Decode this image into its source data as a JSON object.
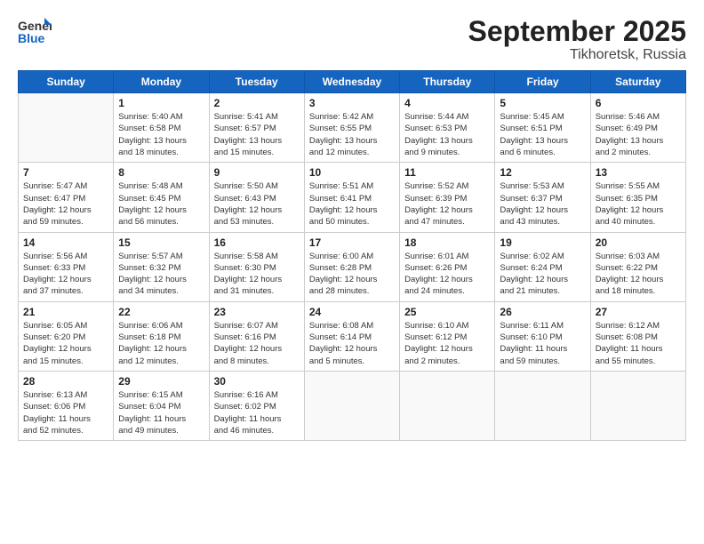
{
  "header": {
    "logo_general": "General",
    "logo_blue": "Blue",
    "title": "September 2025",
    "subtitle": "Tikhoretsk, Russia"
  },
  "days_of_week": [
    "Sunday",
    "Monday",
    "Tuesday",
    "Wednesday",
    "Thursday",
    "Friday",
    "Saturday"
  ],
  "weeks": [
    [
      {
        "day": "",
        "info": ""
      },
      {
        "day": "1",
        "info": "Sunrise: 5:40 AM\nSunset: 6:58 PM\nDaylight: 13 hours\nand 18 minutes."
      },
      {
        "day": "2",
        "info": "Sunrise: 5:41 AM\nSunset: 6:57 PM\nDaylight: 13 hours\nand 15 minutes."
      },
      {
        "day": "3",
        "info": "Sunrise: 5:42 AM\nSunset: 6:55 PM\nDaylight: 13 hours\nand 12 minutes."
      },
      {
        "day": "4",
        "info": "Sunrise: 5:44 AM\nSunset: 6:53 PM\nDaylight: 13 hours\nand 9 minutes."
      },
      {
        "day": "5",
        "info": "Sunrise: 5:45 AM\nSunset: 6:51 PM\nDaylight: 13 hours\nand 6 minutes."
      },
      {
        "day": "6",
        "info": "Sunrise: 5:46 AM\nSunset: 6:49 PM\nDaylight: 13 hours\nand 2 minutes."
      }
    ],
    [
      {
        "day": "7",
        "info": "Sunrise: 5:47 AM\nSunset: 6:47 PM\nDaylight: 12 hours\nand 59 minutes."
      },
      {
        "day": "8",
        "info": "Sunrise: 5:48 AM\nSunset: 6:45 PM\nDaylight: 12 hours\nand 56 minutes."
      },
      {
        "day": "9",
        "info": "Sunrise: 5:50 AM\nSunset: 6:43 PM\nDaylight: 12 hours\nand 53 minutes."
      },
      {
        "day": "10",
        "info": "Sunrise: 5:51 AM\nSunset: 6:41 PM\nDaylight: 12 hours\nand 50 minutes."
      },
      {
        "day": "11",
        "info": "Sunrise: 5:52 AM\nSunset: 6:39 PM\nDaylight: 12 hours\nand 47 minutes."
      },
      {
        "day": "12",
        "info": "Sunrise: 5:53 AM\nSunset: 6:37 PM\nDaylight: 12 hours\nand 43 minutes."
      },
      {
        "day": "13",
        "info": "Sunrise: 5:55 AM\nSunset: 6:35 PM\nDaylight: 12 hours\nand 40 minutes."
      }
    ],
    [
      {
        "day": "14",
        "info": "Sunrise: 5:56 AM\nSunset: 6:33 PM\nDaylight: 12 hours\nand 37 minutes."
      },
      {
        "day": "15",
        "info": "Sunrise: 5:57 AM\nSunset: 6:32 PM\nDaylight: 12 hours\nand 34 minutes."
      },
      {
        "day": "16",
        "info": "Sunrise: 5:58 AM\nSunset: 6:30 PM\nDaylight: 12 hours\nand 31 minutes."
      },
      {
        "day": "17",
        "info": "Sunrise: 6:00 AM\nSunset: 6:28 PM\nDaylight: 12 hours\nand 28 minutes."
      },
      {
        "day": "18",
        "info": "Sunrise: 6:01 AM\nSunset: 6:26 PM\nDaylight: 12 hours\nand 24 minutes."
      },
      {
        "day": "19",
        "info": "Sunrise: 6:02 AM\nSunset: 6:24 PM\nDaylight: 12 hours\nand 21 minutes."
      },
      {
        "day": "20",
        "info": "Sunrise: 6:03 AM\nSunset: 6:22 PM\nDaylight: 12 hours\nand 18 minutes."
      }
    ],
    [
      {
        "day": "21",
        "info": "Sunrise: 6:05 AM\nSunset: 6:20 PM\nDaylight: 12 hours\nand 15 minutes."
      },
      {
        "day": "22",
        "info": "Sunrise: 6:06 AM\nSunset: 6:18 PM\nDaylight: 12 hours\nand 12 minutes."
      },
      {
        "day": "23",
        "info": "Sunrise: 6:07 AM\nSunset: 6:16 PM\nDaylight: 12 hours\nand 8 minutes."
      },
      {
        "day": "24",
        "info": "Sunrise: 6:08 AM\nSunset: 6:14 PM\nDaylight: 12 hours\nand 5 minutes."
      },
      {
        "day": "25",
        "info": "Sunrise: 6:10 AM\nSunset: 6:12 PM\nDaylight: 12 hours\nand 2 minutes."
      },
      {
        "day": "26",
        "info": "Sunrise: 6:11 AM\nSunset: 6:10 PM\nDaylight: 11 hours\nand 59 minutes."
      },
      {
        "day": "27",
        "info": "Sunrise: 6:12 AM\nSunset: 6:08 PM\nDaylight: 11 hours\nand 55 minutes."
      }
    ],
    [
      {
        "day": "28",
        "info": "Sunrise: 6:13 AM\nSunset: 6:06 PM\nDaylight: 11 hours\nand 52 minutes."
      },
      {
        "day": "29",
        "info": "Sunrise: 6:15 AM\nSunset: 6:04 PM\nDaylight: 11 hours\nand 49 minutes."
      },
      {
        "day": "30",
        "info": "Sunrise: 6:16 AM\nSunset: 6:02 PM\nDaylight: 11 hours\nand 46 minutes."
      },
      {
        "day": "",
        "info": ""
      },
      {
        "day": "",
        "info": ""
      },
      {
        "day": "",
        "info": ""
      },
      {
        "day": "",
        "info": ""
      }
    ]
  ]
}
